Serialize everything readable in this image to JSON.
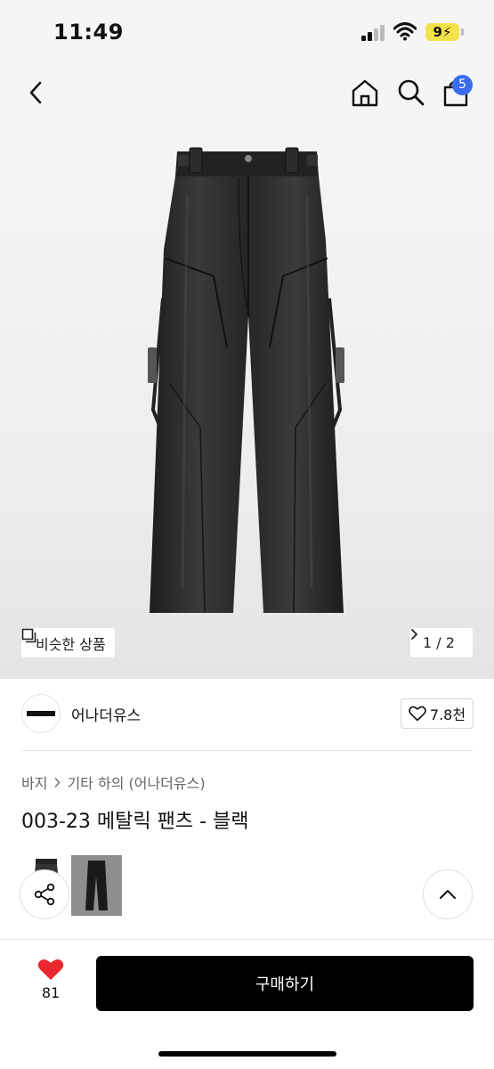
{
  "status_bar": {
    "time": "11:49",
    "battery": "9",
    "icons": [
      "cellular-signal-icon",
      "wifi-icon",
      "battery-charging-icon"
    ]
  },
  "nav": {
    "icons": [
      "back-chevron-icon",
      "home-icon",
      "search-icon",
      "shopping-bag-icon"
    ],
    "cart_count": "5"
  },
  "gallery": {
    "similar_label": "비슷한 상품",
    "page_indicator": "1 / 2"
  },
  "brand": {
    "name": "어나더유스",
    "likes": "7.8천"
  },
  "breadcrumb": [
    "바지",
    "기타 하의 (어나더유스)"
  ],
  "product": {
    "title": "003-23 메탈릭 팬츠 - 블랙"
  },
  "bottom_bar": {
    "wish_count": "81",
    "buy_label": "구매하기"
  },
  "colors": {
    "badge": "#3a6cf0",
    "heart": "#e8282e",
    "buy_button": "#000000",
    "battery": "#f2e14c"
  }
}
